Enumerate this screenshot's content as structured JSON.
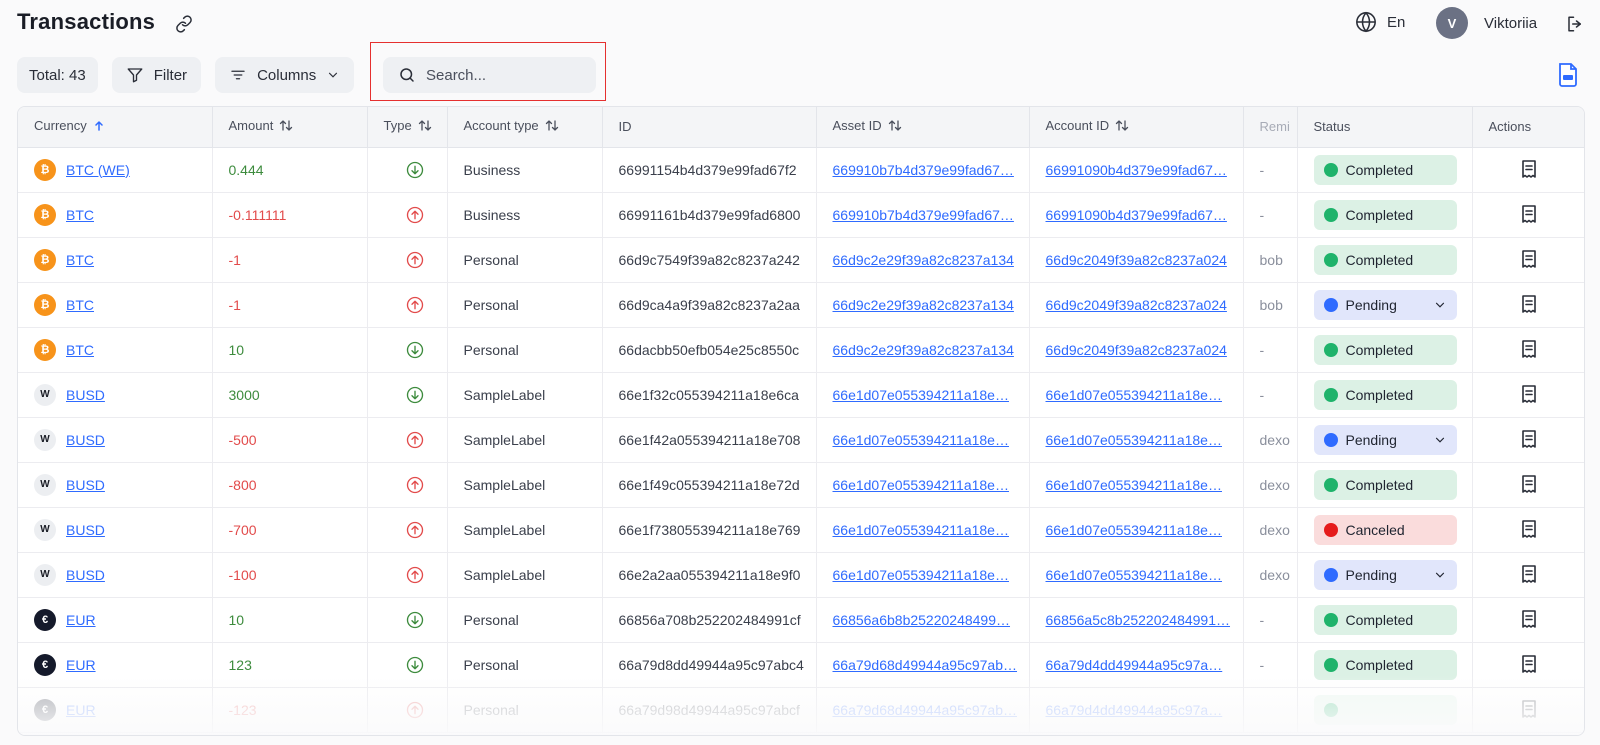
{
  "header": {
    "title": "Transactions",
    "language": "En",
    "user": {
      "initial": "V",
      "name": "Viktoriia"
    }
  },
  "toolbar": {
    "total_label": "Total: 43",
    "filter_label": "Filter",
    "columns_label": "Columns",
    "search_placeholder": "Search..."
  },
  "table": {
    "columns": [
      "Currency",
      "Amount",
      "Type",
      "Account type",
      "ID",
      "Asset ID",
      "Account ID",
      "Remi",
      "Status",
      "Actions"
    ],
    "rows": [
      {
        "currency": "BTC (WE)",
        "coin": "btc",
        "amount": "0.444",
        "type": "in",
        "account_type": "Business",
        "id": "66991154b4d379e99fad67f2",
        "asset_id": "669910b7b4d379e99fad67…",
        "account_id": "66991090b4d379e99fad67…",
        "remi": "-",
        "status": "Completed",
        "status_key": "completed"
      },
      {
        "currency": "BTC",
        "coin": "btc",
        "amount": "-0.111111",
        "type": "out",
        "account_type": "Business",
        "id": "66991161b4d379e99fad6800",
        "asset_id": "669910b7b4d379e99fad67…",
        "account_id": "66991090b4d379e99fad67…",
        "remi": "-",
        "status": "Completed",
        "status_key": "completed"
      },
      {
        "currency": "BTC",
        "coin": "btc",
        "amount": "-1",
        "type": "out",
        "account_type": "Personal",
        "id": "66d9c7549f39a82c8237a242",
        "asset_id": "66d9c2e29f39a82c8237a134",
        "account_id": "66d9c2049f39a82c8237a024",
        "remi": "bob",
        "status": "Completed",
        "status_key": "completed"
      },
      {
        "currency": "BTC",
        "coin": "btc",
        "amount": "-1",
        "type": "out",
        "account_type": "Personal",
        "id": "66d9ca4a9f39a82c8237a2aa",
        "asset_id": "66d9c2e29f39a82c8237a134",
        "account_id": "66d9c2049f39a82c8237a024",
        "remi": "bob",
        "status": "Pending",
        "status_key": "pending"
      },
      {
        "currency": "BTC",
        "coin": "btc",
        "amount": "10",
        "type": "in",
        "account_type": "Personal",
        "id": "66dacbb50efb054e25c8550c",
        "asset_id": "66d9c2e29f39a82c8237a134",
        "account_id": "66d9c2049f39a82c8237a024",
        "remi": "-",
        "status": "Completed",
        "status_key": "completed"
      },
      {
        "currency": "BUSD",
        "coin": "busd",
        "amount": "3000",
        "type": "in",
        "account_type": "SampleLabel",
        "id": "66e1f32c055394211a18e6ca",
        "asset_id": "66e1d07e055394211a18e…",
        "account_id": "66e1d07e055394211a18e…",
        "remi": "-",
        "status": "Completed",
        "status_key": "completed"
      },
      {
        "currency": "BUSD",
        "coin": "busd",
        "amount": "-500",
        "type": "out",
        "account_type": "SampleLabel",
        "id": "66e1f42a055394211a18e708",
        "asset_id": "66e1d07e055394211a18e…",
        "account_id": "66e1d07e055394211a18e…",
        "remi": "dexo",
        "status": "Pending",
        "status_key": "pending"
      },
      {
        "currency": "BUSD",
        "coin": "busd",
        "amount": "-800",
        "type": "out",
        "account_type": "SampleLabel",
        "id": "66e1f49c055394211a18e72d",
        "asset_id": "66e1d07e055394211a18e…",
        "account_id": "66e1d07e055394211a18e…",
        "remi": "dexo",
        "status": "Completed",
        "status_key": "completed"
      },
      {
        "currency": "BUSD",
        "coin": "busd",
        "amount": "-700",
        "type": "out",
        "account_type": "SampleLabel",
        "id": "66e1f738055394211a18e769",
        "asset_id": "66e1d07e055394211a18e…",
        "account_id": "66e1d07e055394211a18e…",
        "remi": "dexo",
        "status": "Canceled",
        "status_key": "canceled"
      },
      {
        "currency": "BUSD",
        "coin": "busd",
        "amount": "-100",
        "type": "out",
        "account_type": "SampleLabel",
        "id": "66e2a2aa055394211a18e9f0",
        "asset_id": "66e1d07e055394211a18e…",
        "account_id": "66e1d07e055394211a18e…",
        "remi": "dexo",
        "status": "Pending",
        "status_key": "pending"
      },
      {
        "currency": "EUR",
        "coin": "eur",
        "amount": "10",
        "type": "in",
        "account_type": "Personal",
        "id": "66856a708b252202484991cf",
        "asset_id": "66856a6b8b25220248499…",
        "account_id": "66856a5c8b252202484991…",
        "remi": "-",
        "status": "Completed",
        "status_key": "completed"
      },
      {
        "currency": "EUR",
        "coin": "eur",
        "amount": "123",
        "type": "in",
        "account_type": "Personal",
        "id": "66a79d8dd49944a95c97abc4",
        "asset_id": "66a79d68d49944a95c97ab…",
        "account_id": "66a79d4dd49944a95c97a…",
        "remi": "-",
        "status": "Completed",
        "status_key": "completed"
      },
      {
        "currency": "EUR",
        "coin": "eur",
        "amount": "-123",
        "type": "out",
        "account_type": "Personal",
        "id": "66a79d98d49944a95c97abcf",
        "asset_id": "66a79d68d49944a95c97ab…",
        "account_id": "66a79d4dd49944a95c97a…",
        "remi": "",
        "status": "",
        "status_key": "completed"
      }
    ]
  },
  "colors": {
    "accent": "#2f6bff",
    "positive": "#3d8b3d",
    "negative": "#e24b4b",
    "completed": "#1fb36b",
    "pending": "#2f6bff",
    "canceled": "#e51c1c",
    "btc": "#f7931a"
  },
  "icons": {
    "copy_link": "link-icon",
    "language": "globe-icon",
    "logout": "logout-icon",
    "filter": "funnel-icon",
    "columns": "columns-icon",
    "search": "search-icon",
    "export": "csv-file-icon",
    "incoming": "arrow-down-circle-icon",
    "outgoing": "arrow-up-circle-icon",
    "action": "receipt-icon"
  }
}
